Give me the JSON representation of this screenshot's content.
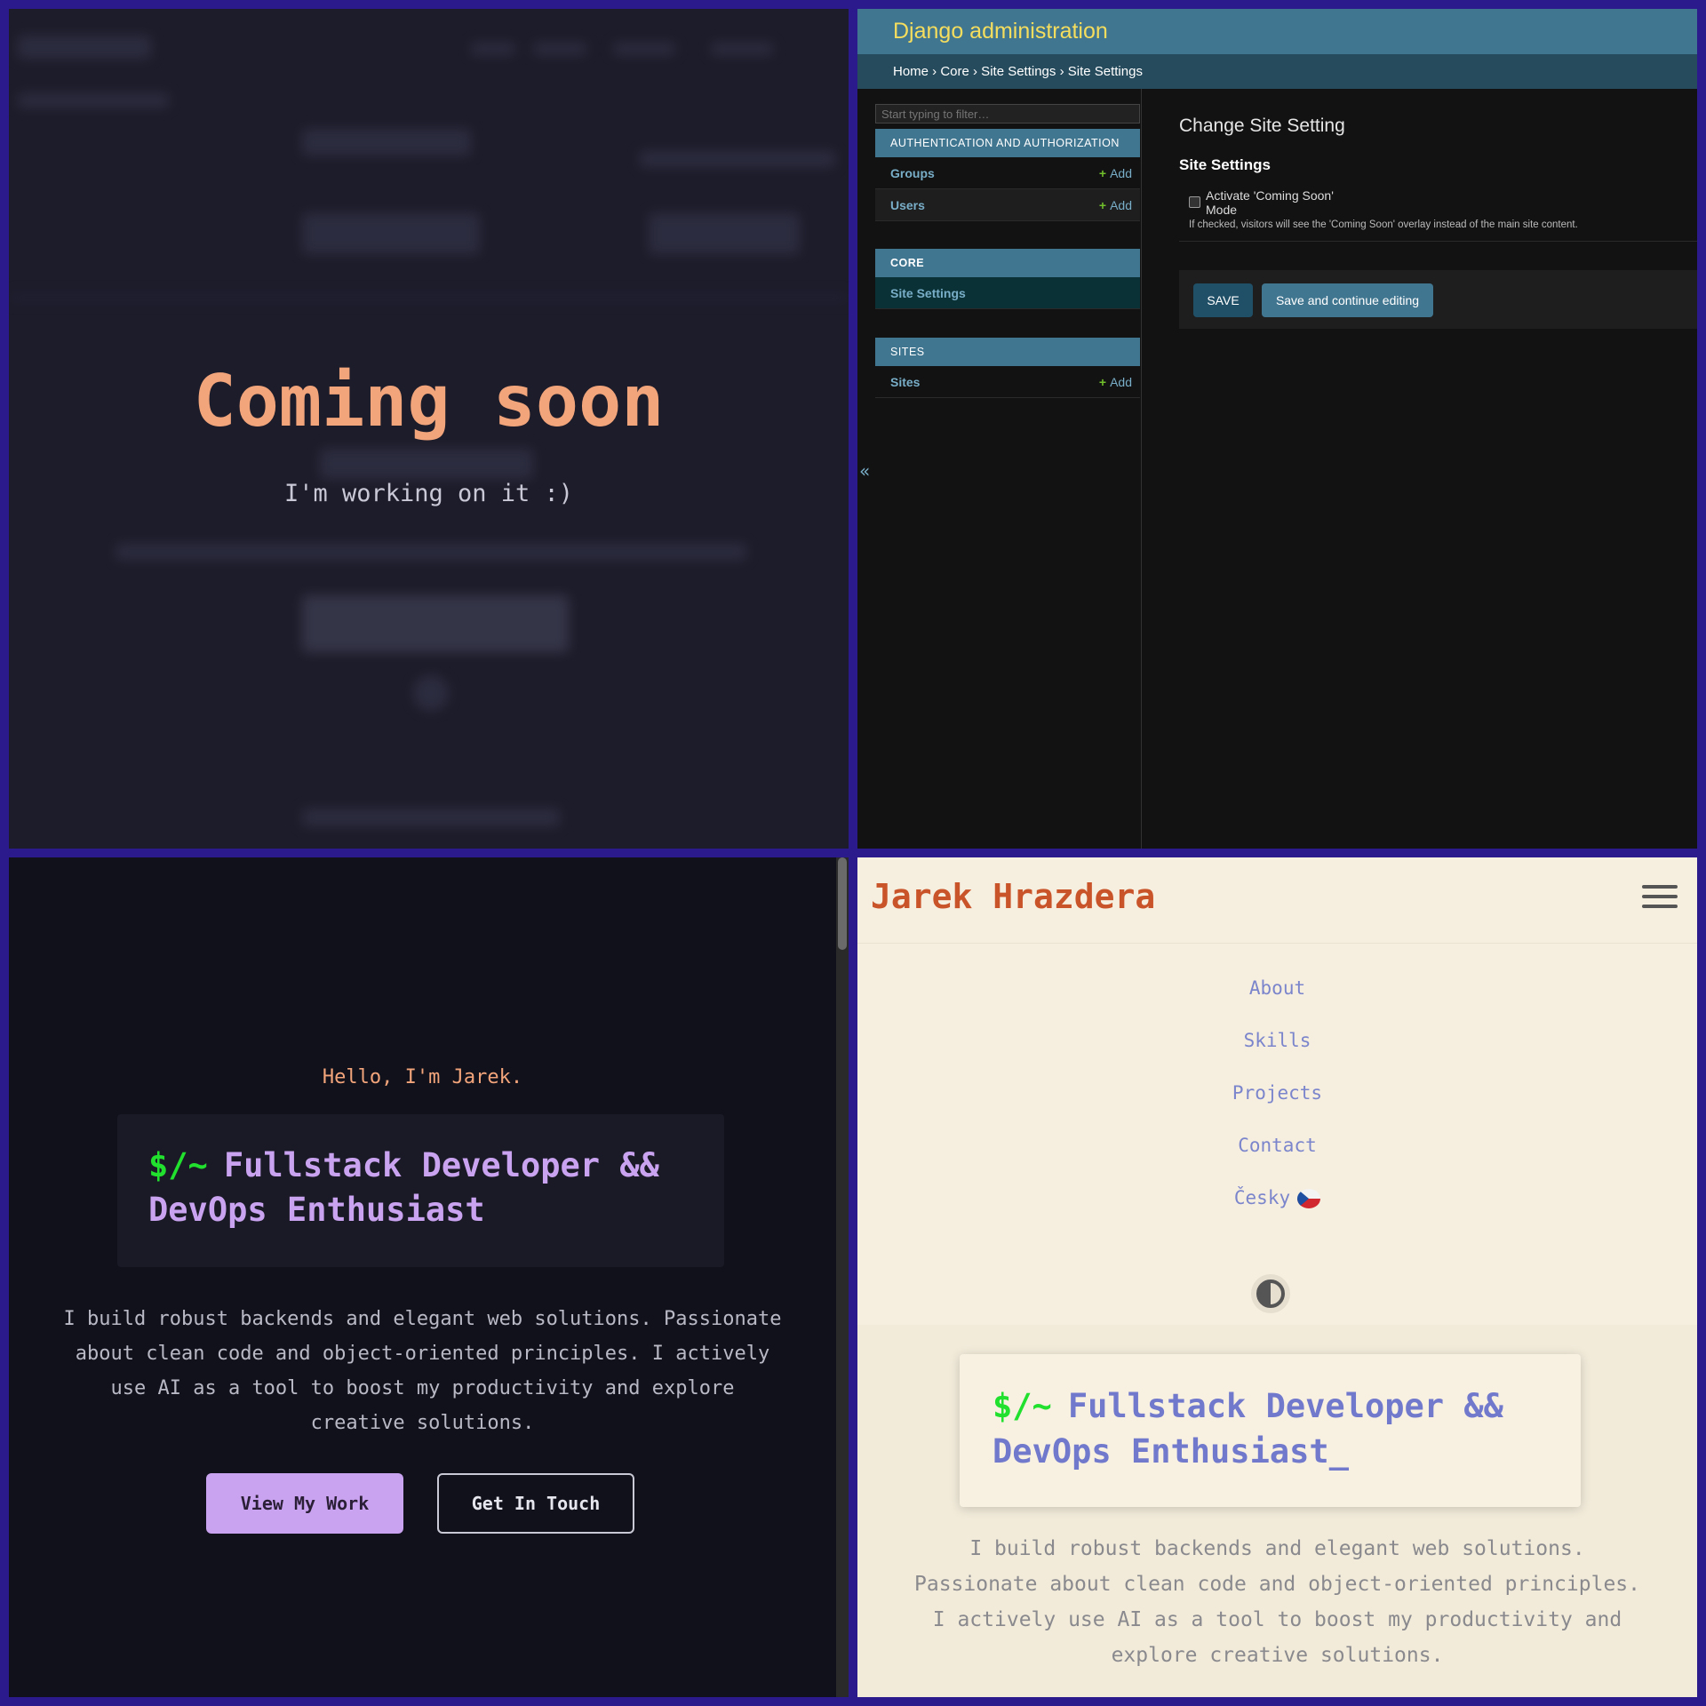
{
  "coming_soon": {
    "title": "Coming soon",
    "subtitle": "I'm working on it :)"
  },
  "django": {
    "branding": "Django administration",
    "breadcrumbs": "Home › Core › Site Settings › Site Settings",
    "filter_placeholder": "Start typing to filter…",
    "modules": [
      {
        "caption": "AUTHENTICATION AND AUTHORIZATION",
        "rows": [
          {
            "label": "Groups",
            "add": "Add"
          },
          {
            "label": "Users",
            "add": "Add"
          }
        ]
      },
      {
        "caption": "CORE",
        "rows": [
          {
            "label": "Site Settings"
          }
        ]
      },
      {
        "caption": "SITES",
        "rows": [
          {
            "label": "Sites",
            "add": "Add"
          }
        ]
      }
    ],
    "sidebar_toggle": "«",
    "page_title": "Change Site Setting",
    "section_title": "Site Settings",
    "checkbox_label": "Activate 'Coming Soon' Mode",
    "checkbox_checked": false,
    "help_text": "If checked, visitors will see the 'Coming Soon' overlay instead of the main site content.",
    "save_label": "SAVE",
    "save_continue_label": "Save and continue editing"
  },
  "dark_site": {
    "hello": "Hello, I'm Jarek.",
    "prompt": "$/~",
    "headline_line1": "Fullstack Developer &&",
    "headline_line2": "DevOps Enthusiast",
    "description": "I build robust backends and elegant web solutions. Passionate about clean code and object-oriented principles. I actively use AI as a tool to boost my productivity and explore creative solutions.",
    "view_work": "View My Work",
    "get_in_touch": "Get In Touch"
  },
  "light_site": {
    "name": "Jarek Hrazdera",
    "nav": [
      "About",
      "Skills",
      "Projects",
      "Contact"
    ],
    "language": "Česky",
    "prompt": "$/~",
    "headline_line1": "Fullstack Developer &&",
    "headline_line2": "DevOps Enthusiast_",
    "description": "I build robust backends and elegant web solutions. Passionate about clean code and object-oriented principles. I actively use AI as a tool to boost my productivity and explore creative solutions."
  }
}
